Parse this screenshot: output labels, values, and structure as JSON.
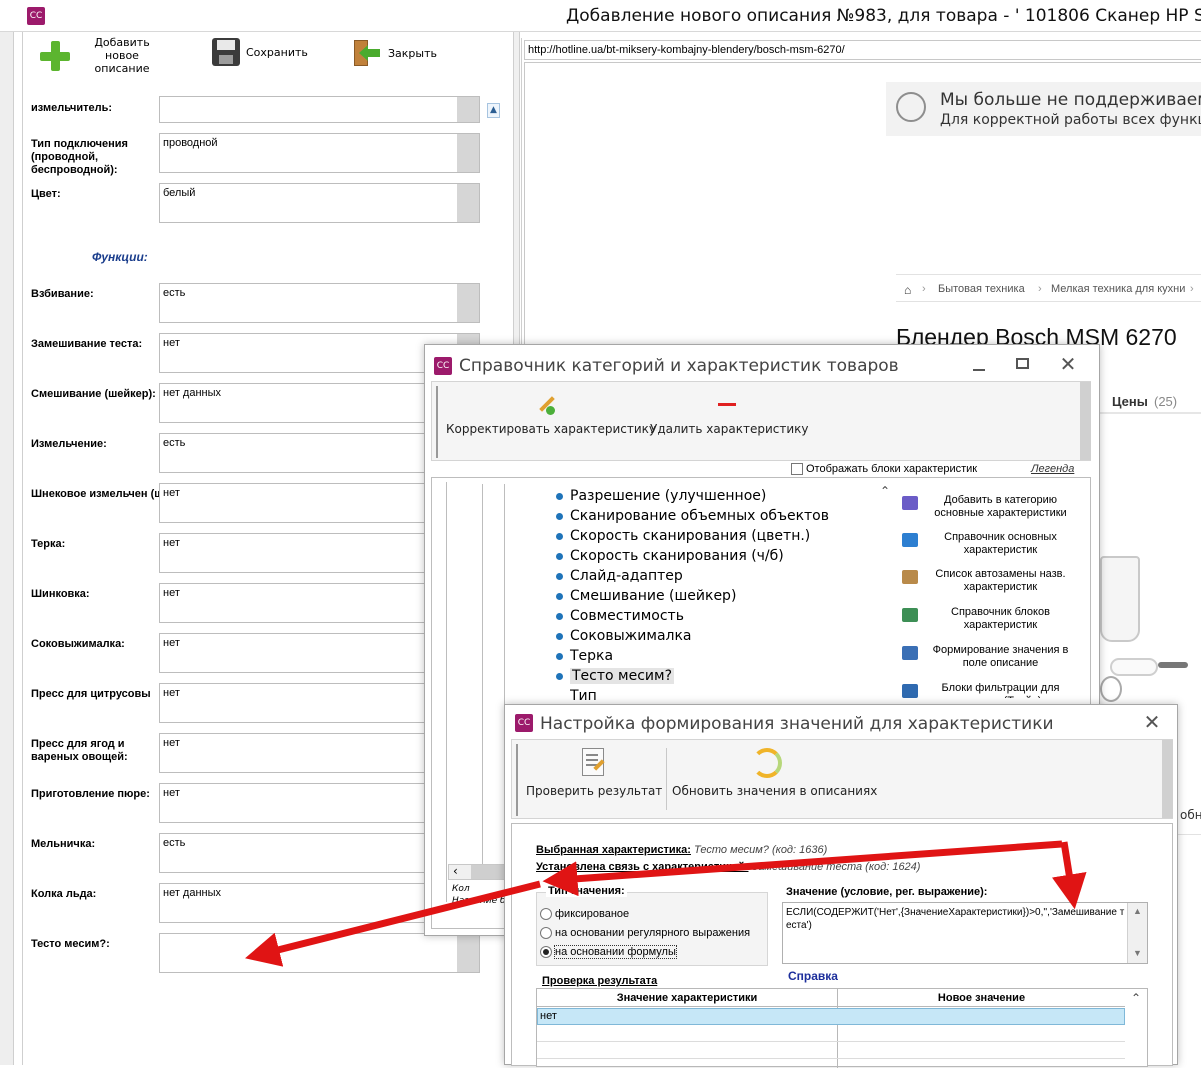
{
  "main_window": {
    "title": "Добавление нового описания №983, для товара - ' 101806 Сканер HP Sca",
    "icon": "app-icon",
    "toolbar": {
      "add_label": "Добавить новое описание",
      "save_label": "Сохранить",
      "close_label": "Закрыть"
    }
  },
  "form": {
    "section_title": "Функции:",
    "fields": [
      {
        "label": "измельчитель:",
        "value": ""
      },
      {
        "label": "Тип подключения (проводной, беспроводной):",
        "value": "проводной"
      },
      {
        "label": "Цвет:",
        "value": "белый"
      },
      {
        "label": "Взбивание:",
        "value": "есть"
      },
      {
        "label": "Замешивание теста:",
        "value": "нет"
      },
      {
        "label": "Смешивание (шейкер):",
        "value": "нет данных"
      },
      {
        "label": "Измельчение:",
        "value": "есть"
      },
      {
        "label": "Шнековое измельчен (шнековая мясорубка",
        "value": "нет"
      },
      {
        "label": "Терка:",
        "value": "нет"
      },
      {
        "label": "Шинковка:",
        "value": "нет"
      },
      {
        "label": "Соковыжималка:",
        "value": "нет"
      },
      {
        "label": "Пресс для цитрусовы",
        "value": "нет"
      },
      {
        "label": "Пресс для ягод и вареных овощей:",
        "value": "нет"
      },
      {
        "label": "Приготовление пюре:",
        "value": "нет"
      },
      {
        "label": "Мельничка:",
        "value": "есть"
      },
      {
        "label": "Колка льда:",
        "value": "нет данных"
      },
      {
        "label": "Тесто месим?:",
        "value": ""
      }
    ]
  },
  "browser": {
    "url": "http://hotline.ua/bt-miksery-kombajny-blendery/bosch-msm-6270/",
    "notice_title": "Мы больше не поддерживаем",
    "notice_text": "Для корректной работы всех функций",
    "breadcrumb": [
      "Бытовая техника",
      "Мелкая техника для кухни"
    ],
    "product_title": "Блендер Bosch MSM 6270",
    "tab_prices": "Цены",
    "tab_prices_count": "(25)",
    "side_text": "обн"
  },
  "dialog1": {
    "title": "Справочник категорий и характеристик товаров",
    "edit_label": "Корректировать характеристику",
    "delete_label": "Удалить характеристику",
    "show_blocks_label": "Отображать блоки характеристик",
    "legend_label": "Легенда",
    "tree_items": [
      "Разрешение (улучшенное)",
      "Сканирование объемных объектов",
      "Скорость сканирования (цветн.)",
      "Скорость сканирования (ч/б)",
      "Слайд-адаптер",
      "Смешивание (шейкер)",
      "Совместимость",
      "Соковыжималка",
      "Терка",
      "Тесто месим?",
      "Тип"
    ],
    "selected_item": "Тесто месим?",
    "actions": [
      {
        "label": "Добавить в категорию основные характеристики",
        "icon": "puzzle-icon",
        "color": "#6b5cc7"
      },
      {
        "label": "Справочник основных характеристик",
        "icon": "edit-book-icon",
        "color": "#2d7fd1"
      },
      {
        "label": "Список автозамены назв. характеристик",
        "icon": "list-edit-icon",
        "color": "#b98a4a"
      },
      {
        "label": "Справочник блоков характеристик",
        "icon": "table-icon",
        "color": "#3d8f55"
      },
      {
        "label": "Формирование значения в поле описание",
        "icon": "formula-icon",
        "color": "#3a6fb5"
      },
      {
        "label": "Блоки фильтрации для товаров (Трейн)",
        "icon": "filter-block-icon",
        "color": "#2f6ab0"
      }
    ],
    "bottom_text1": "Кол",
    "bottom_text2": "Название бл"
  },
  "dialog2": {
    "title": "Настройка формирования значений для характеристики",
    "check_label": "Проверить результат",
    "update_label": "Обновить значения в описаниях",
    "selected_char_label": "Выбранная характеристика:",
    "selected_char_value": "Тесто месим? (код: 1636)",
    "link_label": "Установлена связь с характеристикой:",
    "link_value": "Замешивание теста (код: 1624)",
    "value_type_title": "Тип значения:",
    "radio_options": [
      "фиксированое",
      "на основании регулярного выражения",
      "на основании формулы"
    ],
    "radio_selected": 2,
    "value_title": "Значение (условие, рег. выражение):",
    "formula": "ЕСЛИ(СОДЕРЖИТ('Нет',{ЗначениеХарактеристики})>0,'','Замешивание теста')",
    "help_link": "Справка",
    "result_title": "Проверка результата",
    "columns": [
      "Значение характеристики",
      "Новое значение"
    ],
    "rows": [
      [
        "нет",
        ""
      ]
    ]
  },
  "colors": {
    "brand": "#9c1a6b",
    "arrow": "#e01414",
    "selected_row": "#c6e7f7"
  }
}
